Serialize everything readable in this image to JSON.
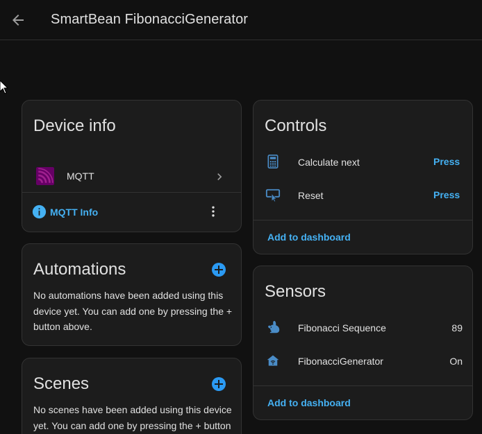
{
  "header": {
    "title": "SmartBean FibonacciGenerator"
  },
  "device_info": {
    "title": "Device info",
    "integration": "MQTT",
    "info_link": "MQTT Info"
  },
  "automations": {
    "title": "Automations",
    "empty_text": "No automations have been added using this device yet. You can add one by pressing the + button above."
  },
  "scenes": {
    "title": "Scenes",
    "empty_text": "No scenes have been added using this device yet. You can add one by pressing the + button above."
  },
  "controls": {
    "title": "Controls",
    "items": [
      {
        "label": "Calculate next",
        "action": "Press",
        "icon": "calculator-icon"
      },
      {
        "label": "Reset",
        "action": "Press",
        "icon": "gesture-tap-button-icon"
      }
    ],
    "add_to_dashboard": "Add to dashboard"
  },
  "sensors": {
    "title": "Sensors",
    "items": [
      {
        "label": "Fibonacci Sequence",
        "value": "89",
        "icon": "rabbit-icon"
      },
      {
        "label": "FibonacciGenerator",
        "value": "On",
        "icon": "home-signal-icon"
      }
    ],
    "add_to_dashboard": "Add to dashboard"
  },
  "colors": {
    "accent": "#45b1f3",
    "add_button": "#2b9af3",
    "mqtt": "#660066",
    "icon": "#4a8cc7"
  }
}
